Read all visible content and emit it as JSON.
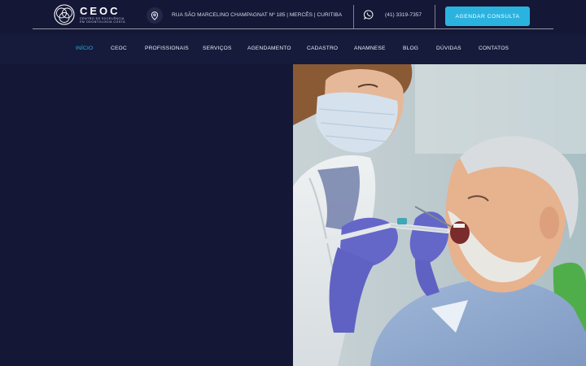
{
  "header": {
    "logo_name": "CEOC",
    "logo_tag_line1": "CENTRO DE EXCELÊNCIA",
    "logo_tag_line2": "EM ODONTOLOGIA COSTA",
    "address": "RUA SÃO MARCELINO CHAMPAGNAT Nº 185 | MERCÊS | CURITIBA",
    "phone": "(41) 3319-7357",
    "cta_label": "AGENDAR CONSULTA"
  },
  "nav": {
    "items": [
      {
        "label": "INÍCIO",
        "active": true
      },
      {
        "label": "CEOC"
      },
      {
        "label": "PROFISSIONAIS"
      },
      {
        "label": "SERVIÇOS"
      },
      {
        "label": "AGENDAMENTO"
      },
      {
        "label": "CADASTRO"
      },
      {
        "label": "ANAMNESE"
      },
      {
        "label": "BLOG"
      },
      {
        "label": "DÚVIDAS"
      },
      {
        "label": "CONTATOS"
      }
    ]
  },
  "hero": {
    "heading": ""
  },
  "colors": {
    "background": "#141735",
    "nav_background": "#161a3b",
    "accent": "#2bb3e0"
  },
  "icons": {
    "location": "map-pin-icon",
    "whatsapp": "whatsapp-icon",
    "logo": "ceoc-logo-icon"
  }
}
